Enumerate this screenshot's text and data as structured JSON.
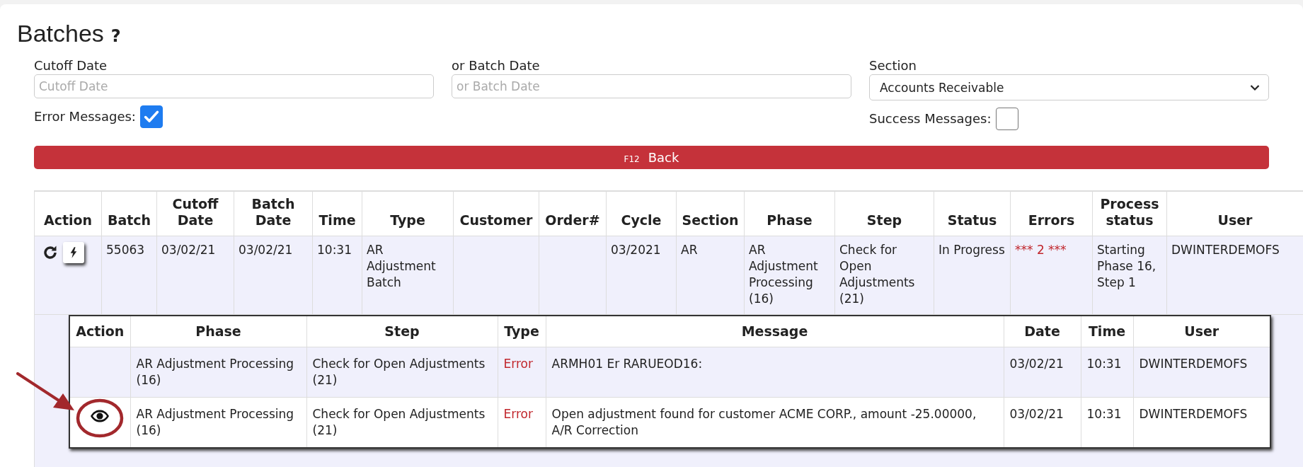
{
  "page": {
    "title": "Batches",
    "help": "?"
  },
  "filters": {
    "cutoff_date": {
      "label": "Cutoff Date",
      "placeholder": "Cutoff Date"
    },
    "batch_date": {
      "label": "or Batch Date",
      "placeholder": "or Batch Date"
    },
    "section": {
      "label": "Section",
      "value": "Accounts Receivable"
    },
    "error_messages": {
      "label": "Error Messages:",
      "checked": true
    },
    "success_messages": {
      "label": "Success Messages:",
      "checked": false
    }
  },
  "back_button": {
    "key": "F12",
    "label": "Back"
  },
  "batches_table": {
    "columns": [
      "Action",
      "Batch",
      "Cutoff Date",
      "Batch Date",
      "Time",
      "Type",
      "Customer",
      "Order#",
      "Cycle",
      "Section",
      "Phase",
      "Step",
      "Status",
      "Errors",
      "Process status",
      "User"
    ],
    "rows": [
      {
        "batch": "55063",
        "cutoff_date": "03/02/21",
        "batch_date": "03/02/21",
        "time": "10:31",
        "type": "AR Adjustment Batch",
        "customer": "",
        "order": "",
        "cycle": "03/2021",
        "section": "AR",
        "phase": "AR Adjustment Processing (16)",
        "step": "Check for Open Adjustments (21)",
        "status": "In Progress",
        "errors": "*** 2 ***",
        "process_status": "Starting Phase 16, Step 1",
        "user": "DWINTERDEMOFS"
      }
    ]
  },
  "messages_table": {
    "columns": [
      "Action",
      "Phase",
      "Step",
      "Type",
      "Message",
      "Date",
      "Time",
      "User"
    ],
    "rows": [
      {
        "view_action": false,
        "highlighted": false,
        "phase": "AR Adjustment Processing (16)",
        "step": "Check for Open Adjustments (21)",
        "type": "Error",
        "message": "ARMH01 Er RARUEOD16:",
        "date": "03/02/21",
        "time": "10:31",
        "user": "DWINTERDEMOFS"
      },
      {
        "view_action": true,
        "highlighted": true,
        "phase": "AR Adjustment Processing (16)",
        "step": "Check for Open Adjustments (21)",
        "type": "Error",
        "message": "Open adjustment found for customer ACME CORP., amount -25.00000, A/R Correction",
        "date": "03/02/21",
        "time": "10:31",
        "user": "DWINTERDEMOFS"
      }
    ]
  }
}
